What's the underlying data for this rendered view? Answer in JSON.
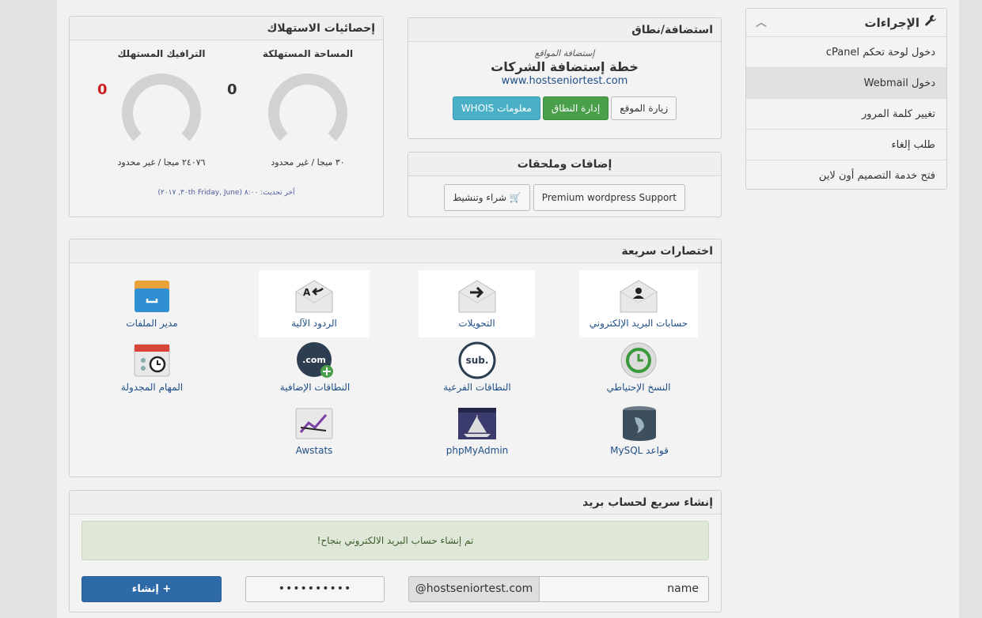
{
  "sidebar": {
    "title": "الإجراءات",
    "items": [
      {
        "label": "دخول لوحة تحكم cPanel"
      },
      {
        "label": "دخول Webmail"
      },
      {
        "label": "تغيير كلمة المرور"
      },
      {
        "label": "طلب إلغاء"
      },
      {
        "label": "فتح خدمة التصميم أون لاين"
      }
    ],
    "active_index": 1
  },
  "usage": {
    "title": "إحصائيات الاستهلاك",
    "disk": {
      "title": "المساحة المستهلكة",
      "value": "0",
      "detail": "٣٠ ميجا / غير محدود"
    },
    "bandwidth": {
      "title": "الترافيك المستهلك",
      "value": "0",
      "detail": "٢٤٠٧٦ ميجا / غير محدود"
    },
    "updated": "آخر تحديث: ٨:٠٠ (Friday, June ٣٠th, ٢٠١٧)"
  },
  "hosting": {
    "title": "استضافة/نطاق",
    "label": "إستضافة المواقع",
    "plan": "خطة إستضافة الشركات",
    "domain": "www.hostseniortest.com",
    "buttons": {
      "visit": "زيارة الموقع",
      "manage": "إدارة النطاق",
      "whois": "معلومات WHOIS"
    }
  },
  "addons": {
    "title": "إضافات وملحقات",
    "buy": "شراء وتنشيط",
    "wordpress": "Premium wordpress Support"
  },
  "shortcuts": {
    "title": "اختصارات سريعة",
    "items": [
      {
        "label": "حسابات البريد الإلكتروني",
        "icon": "email-accounts-icon"
      },
      {
        "label": "التحويلات",
        "icon": "forwarders-icon"
      },
      {
        "label": "الردود الآلية",
        "icon": "autoresponders-icon"
      },
      {
        "label": "مدير الملفات",
        "icon": "file-manager-icon"
      },
      {
        "label": "النسخ الإحتياطي",
        "icon": "backup-icon"
      },
      {
        "label": "النطاقات الفرعية",
        "icon": "subdomains-icon",
        "icon_text": "sub."
      },
      {
        "label": "النطاقات الإضافية",
        "icon": "addon-domains-icon",
        "icon_text": ".com"
      },
      {
        "label": "المهام المجدولة",
        "icon": "cron-jobs-icon"
      },
      {
        "label": "قواعد MySQL",
        "icon": "mysql-icon"
      },
      {
        "label": "phpMyAdmin",
        "icon": "phpmyadmin-icon"
      },
      {
        "label": "Awstats",
        "icon": "awstats-icon"
      }
    ]
  },
  "quick_email": {
    "title": "إنشاء سريع لحساب بريد",
    "success": "تم إنشاء حساب البريد الالكتروني بنجاح!",
    "username": "name",
    "domain": "@hostseniortest.com",
    "password": "••••••••••",
    "create": "+ إنشاء"
  },
  "colors": {
    "link": "#1f4f87",
    "green": "#4aa04a",
    "teal": "#4ab0c8",
    "primary": "#2f6aa8",
    "red_value": "#cc2222"
  }
}
